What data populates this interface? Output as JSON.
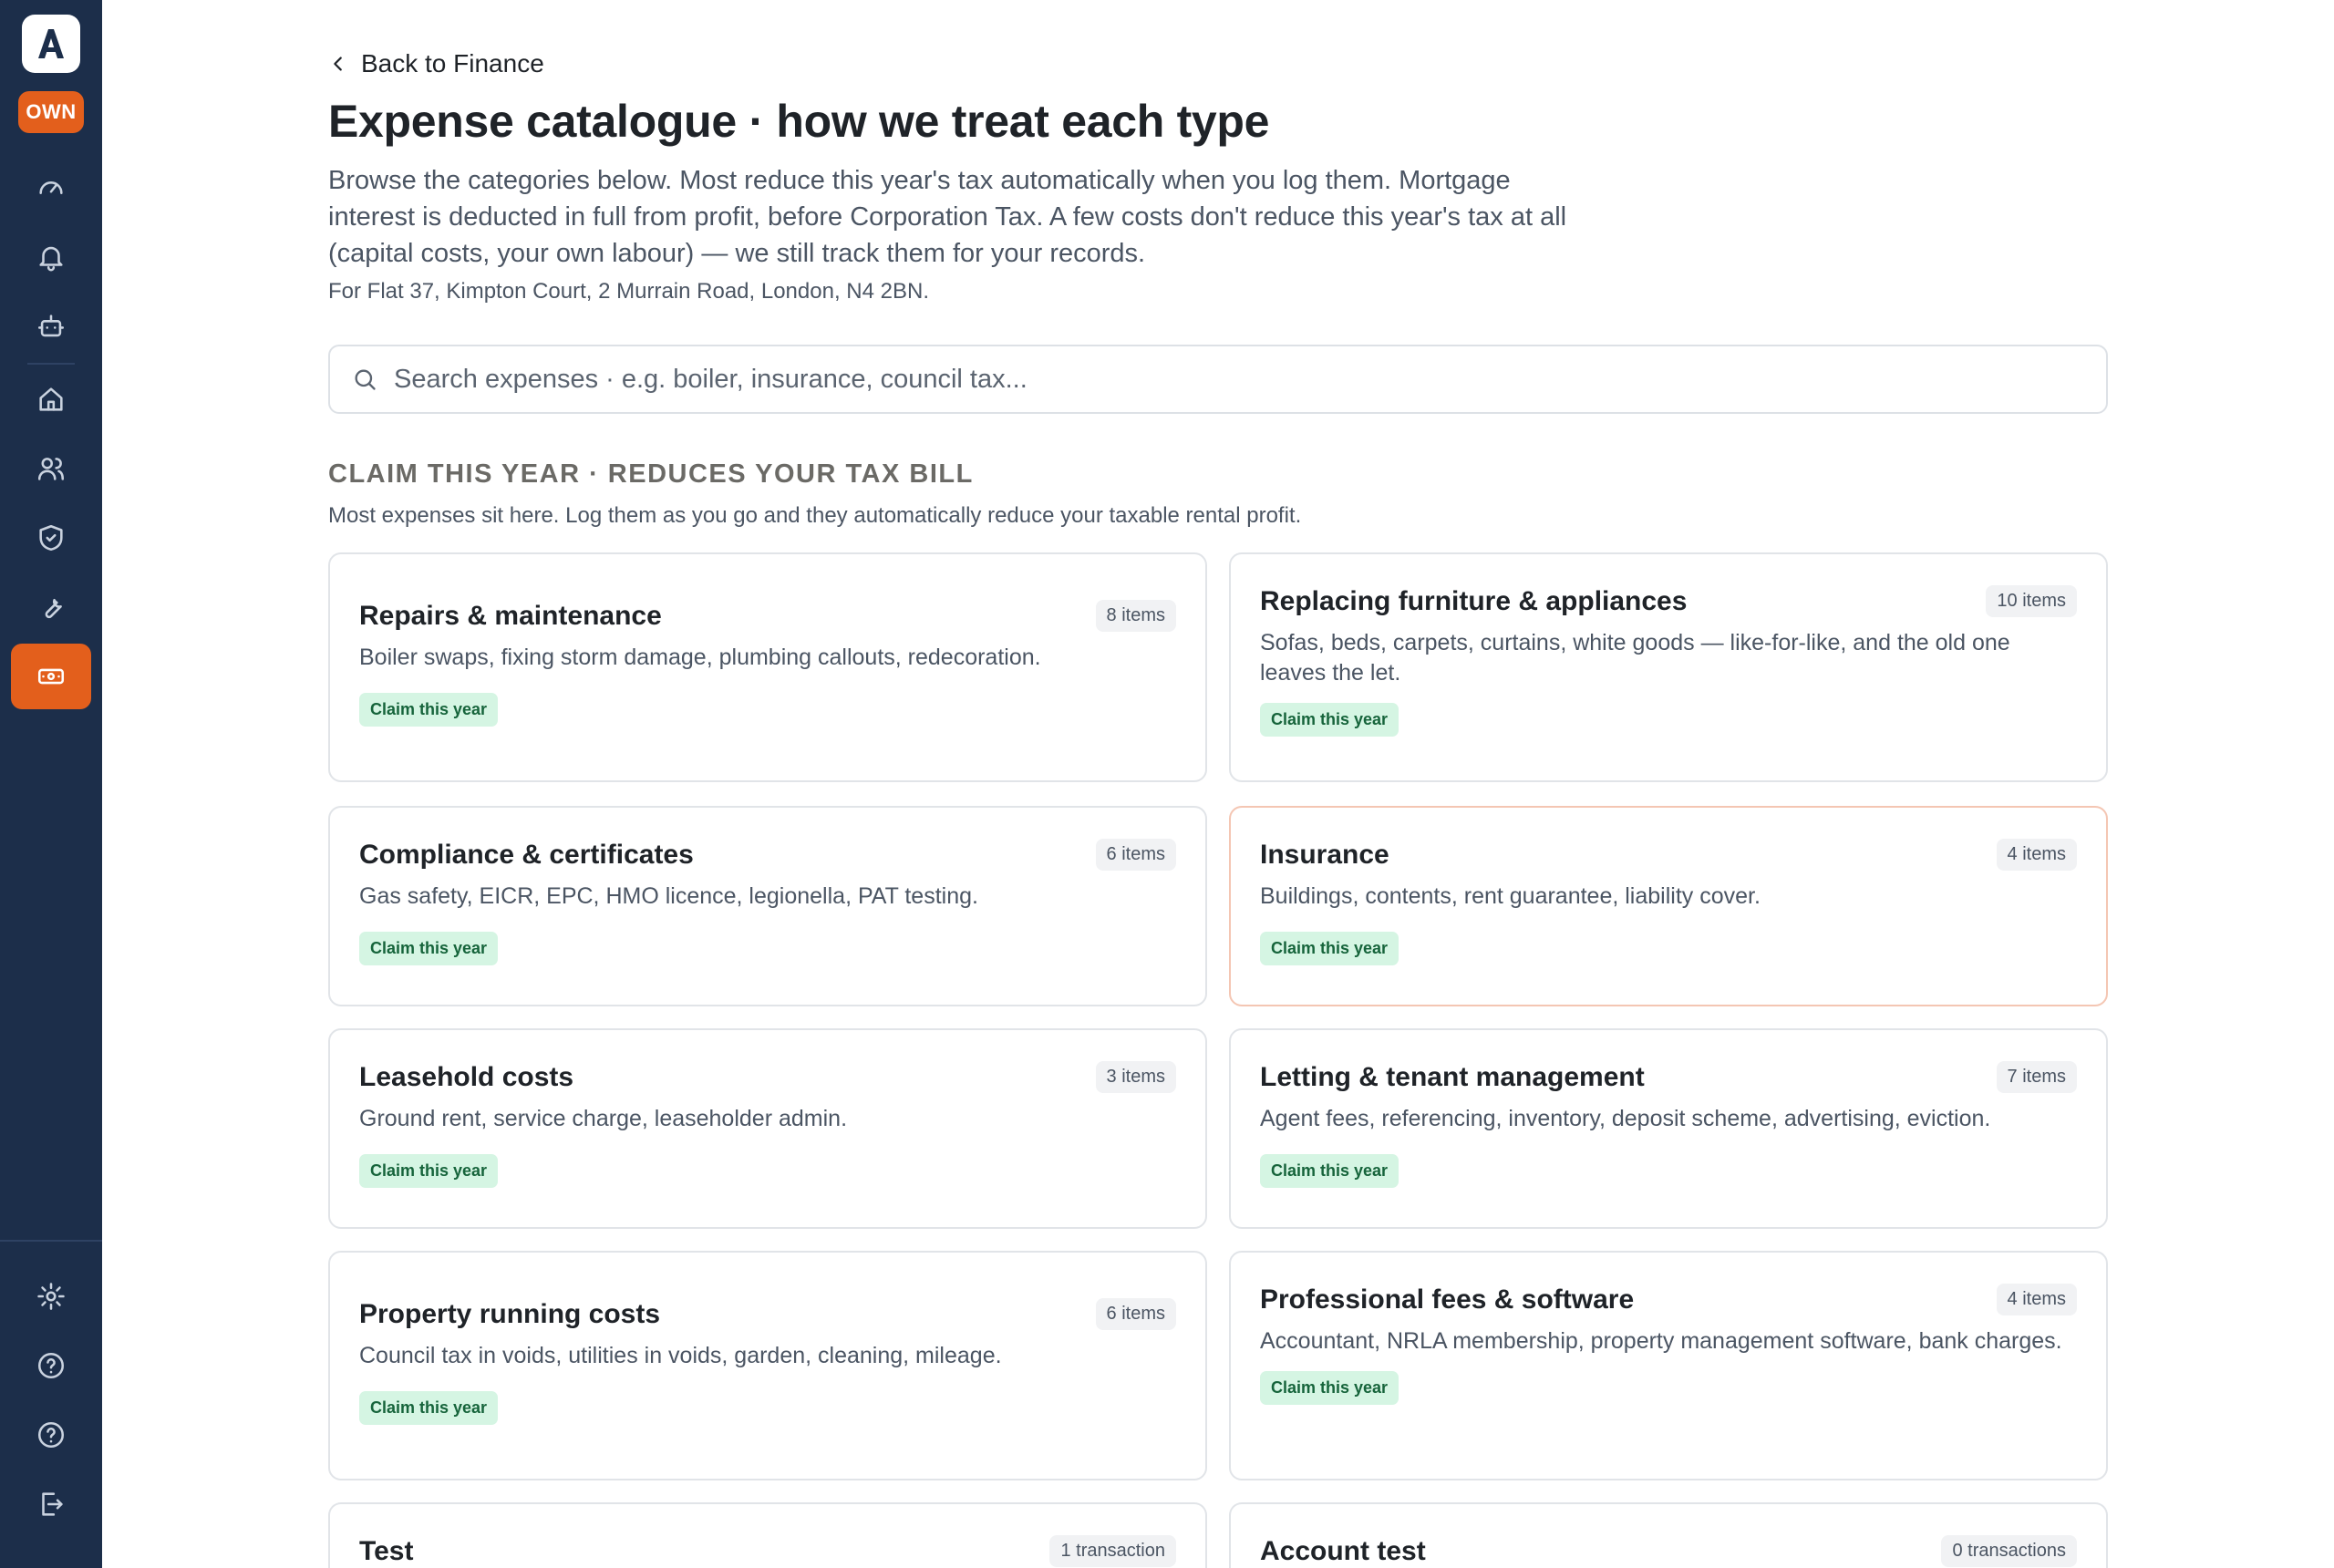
{
  "app": {
    "logo_letter": "A",
    "role_badge": "OWN"
  },
  "sidebar": {
    "items": [
      {
        "icon": "gauge-icon"
      },
      {
        "icon": "bell-icon"
      },
      {
        "icon": "robot-icon"
      },
      {
        "icon": "home-icon"
      },
      {
        "icon": "users-icon"
      },
      {
        "icon": "shield-check-icon"
      },
      {
        "icon": "wrench-icon"
      },
      {
        "icon": "banknote-icon",
        "active": true
      },
      {
        "icon": "gear-icon"
      },
      {
        "icon": "help-circle-icon"
      },
      {
        "icon": "help-circle-icon"
      },
      {
        "icon": "logout-icon"
      }
    ]
  },
  "header": {
    "back_label": "Back to Finance",
    "title": "Expense catalogue · how we treat each type",
    "intro": "Browse the categories below. Most reduce this year's tax automatically when you log them. Mortgage interest is deducted in full from profit, before Corporation Tax. A few costs don't reduce this year's tax at all (capital costs, your own labour) — we still track them for your records.",
    "address": "For Flat 37, Kimpton Court, 2 Murrain Road, London, N4 2BN."
  },
  "search": {
    "placeholder": "Search expenses · e.g. boiler, insurance, council tax..."
  },
  "section": {
    "title": "CLAIM THIS YEAR · REDUCES YOUR TAX BILL",
    "subtitle": "Most expenses sit here. Log them as you go and they automatically reduce your taxable rental profit."
  },
  "cards": [
    {
      "title": "Repairs & maintenance",
      "count": "8 items",
      "description": "Boiler swaps, fixing storm damage, plumbing callouts, redecoration.",
      "tag": "Claim this year"
    },
    {
      "title": "Replacing furniture & appliances",
      "count": "10 items",
      "description": "Sofas, beds, carpets, curtains, white goods — like-for-like, and the old one leaves the let.",
      "tag": "Claim this year"
    },
    {
      "title": "Compliance & certificates",
      "count": "6 items",
      "description": "Gas safety, EICR, EPC, HMO licence, legionella, PAT testing.",
      "tag": "Claim this year"
    },
    {
      "title": "Insurance",
      "count": "4 items",
      "description": "Buildings, contents, rent guarantee, liability cover.",
      "tag": "Claim this year"
    },
    {
      "title": "Leasehold costs",
      "count": "3 items",
      "description": "Ground rent, service charge, leaseholder admin.",
      "tag": "Claim this year"
    },
    {
      "title": "Letting & tenant management",
      "count": "7 items",
      "description": "Agent fees, referencing, inventory, deposit scheme, advertising, eviction.",
      "tag": "Claim this year"
    },
    {
      "title": "Property running costs",
      "count": "6 items",
      "description": "Council tax in voids, utilities in voids, garden, cleaning, mileage.",
      "tag": "Claim this year"
    },
    {
      "title": "Professional fees & software",
      "count": "4 items",
      "description": "Accountant, NRLA membership, property management software, bank charges.",
      "tag": "Claim this year"
    },
    {
      "title": "Test",
      "count": "1 transaction",
      "description": "",
      "tag": ""
    },
    {
      "title": "Account test",
      "count": "0 transactions",
      "description": "",
      "tag": ""
    }
  ],
  "colors": {
    "sidebar_bg": "#1c2e4a",
    "accent": "#e35f1c",
    "tag_bg": "#d5f5e3",
    "tag_text": "#16643b"
  }
}
